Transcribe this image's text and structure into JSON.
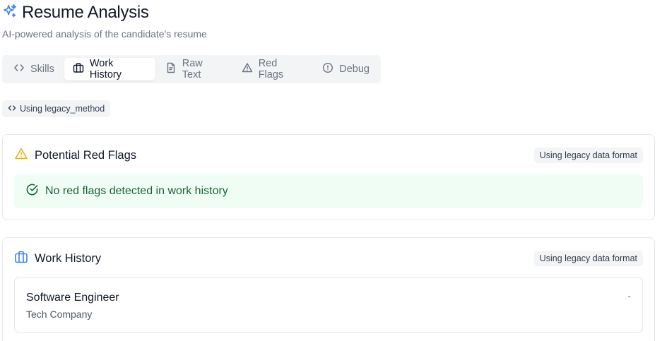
{
  "header": {
    "title": "Resume Analysis",
    "subtitle": "AI-powered analysis of the candidate's resume",
    "icon": "sparkles-icon",
    "accent_color": "#3b82f6"
  },
  "tabs": [
    {
      "label": "Skills",
      "icon": "code-icon",
      "active": false
    },
    {
      "label": "Work History",
      "icon": "briefcase-icon",
      "active": true
    },
    {
      "label": "Raw Text",
      "icon": "file-text-icon",
      "active": false
    },
    {
      "label": "Red Flags",
      "icon": "alert-triangle-icon",
      "active": false
    },
    {
      "label": "Debug",
      "icon": "info-circle-icon",
      "active": false
    }
  ],
  "method_badge": {
    "label": "Using legacy_method",
    "icon": "code-icon"
  },
  "red_flags_card": {
    "title": "Potential Red Flags",
    "icon": "alert-triangle-icon",
    "icon_color": "#eab308",
    "badge": "Using legacy data format",
    "message": "No red flags detected in work history",
    "message_icon": "check-circle-icon",
    "message_color": "#166534"
  },
  "work_history_card": {
    "title": "Work History",
    "icon": "briefcase-icon",
    "icon_color": "#3b82f6",
    "badge": "Using legacy data format",
    "jobs": [
      {
        "title": "Software Engineer",
        "company": "Tech Company",
        "dates": "-"
      }
    ]
  }
}
